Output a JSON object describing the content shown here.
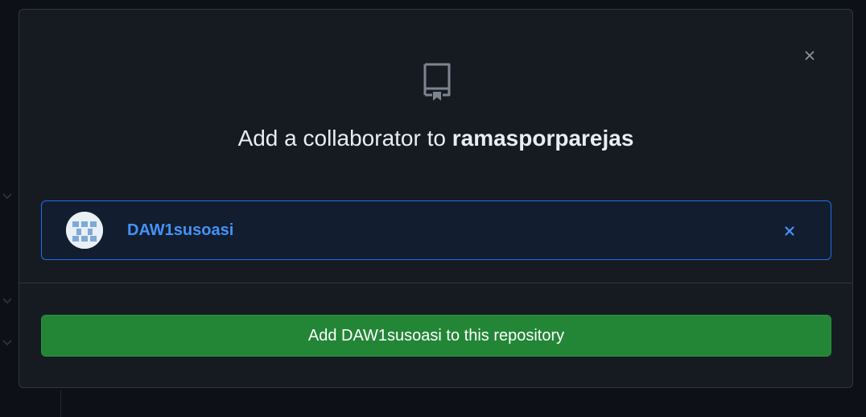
{
  "dialog": {
    "title_prefix": "Add a collaborator to ",
    "repository_name": "ramasporparejas",
    "close_icon": "close-icon",
    "repo_icon": "repo-icon"
  },
  "selected_user": {
    "username": "DAW1susoasi",
    "avatar_icon": "identicon-avatar",
    "remove_icon": "close-icon"
  },
  "add_button": {
    "label": "Add DAW1susoasi to this repository"
  },
  "colors": {
    "background": "#0d1117",
    "modal": "#161b22",
    "border": "#30363d",
    "accent_blue": "#4493f8",
    "selected_bg": "#121d2f",
    "primary_green": "#238636"
  }
}
